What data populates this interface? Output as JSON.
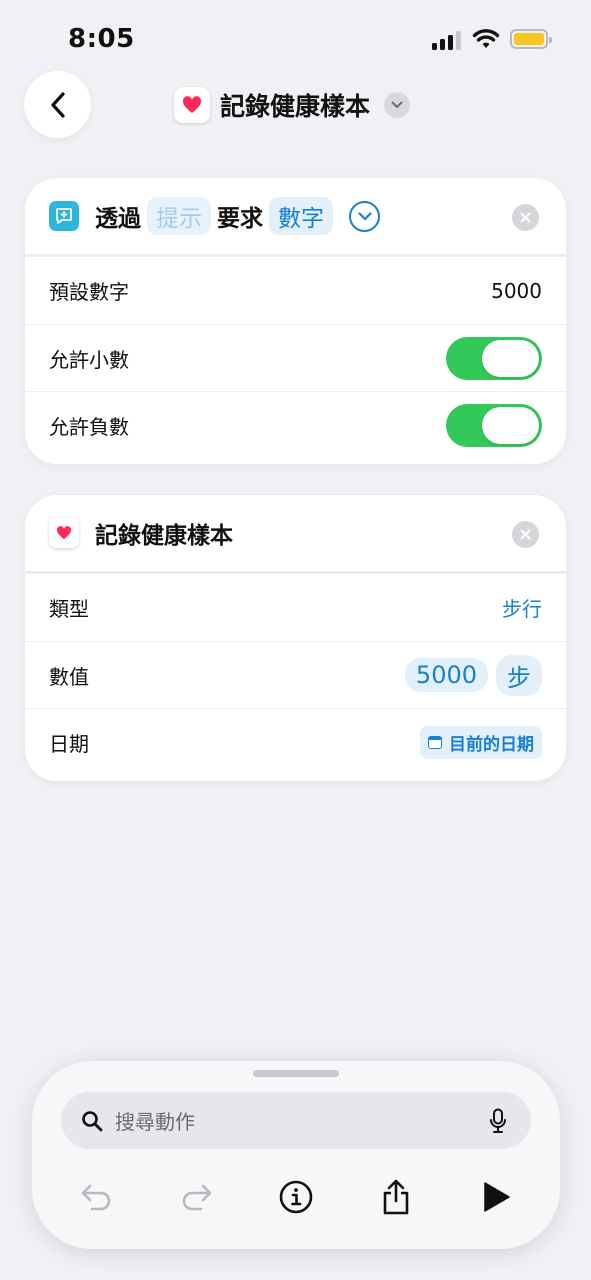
{
  "status_bar": {
    "time": "8:05"
  },
  "nav": {
    "title": "記錄健康樣本"
  },
  "card1": {
    "header": {
      "prefix": "透過",
      "token_placeholder": "提示",
      "middle": "要求",
      "token_type": "數字"
    },
    "rows": [
      {
        "label": "預設數字",
        "value": "5000"
      },
      {
        "label": "允許小數",
        "toggle": true
      },
      {
        "label": "允許負數",
        "toggle": true
      }
    ]
  },
  "card2": {
    "header": {
      "title": "記錄健康樣本"
    },
    "rows": [
      {
        "label": "類型",
        "value": "步行"
      },
      {
        "label": "數值",
        "value_number": "5000",
        "value_unit": "步"
      },
      {
        "label": "日期",
        "value": "目前的日期"
      }
    ]
  },
  "bottom": {
    "search_placeholder": "搜尋動作"
  },
  "colors": {
    "accent": "#1a7fd1",
    "toggle_on": "#34c759",
    "health": "#ff2d55",
    "prompt_icon": "#2eb6df"
  }
}
